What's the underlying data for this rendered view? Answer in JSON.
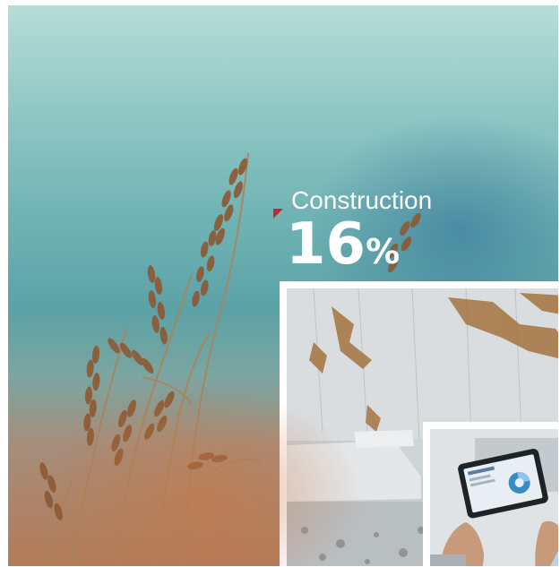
{
  "stat": {
    "label": "Construction",
    "value": "16",
    "unit": "%"
  },
  "images": {
    "background": "wheat-grass-photo",
    "primary_inset": "marble-quarry-photo",
    "secondary_inset": "tablet-in-hands-photo"
  },
  "colors": {
    "accent": "#c2262e",
    "text": "#ffffff",
    "frame": "#ffffff"
  }
}
